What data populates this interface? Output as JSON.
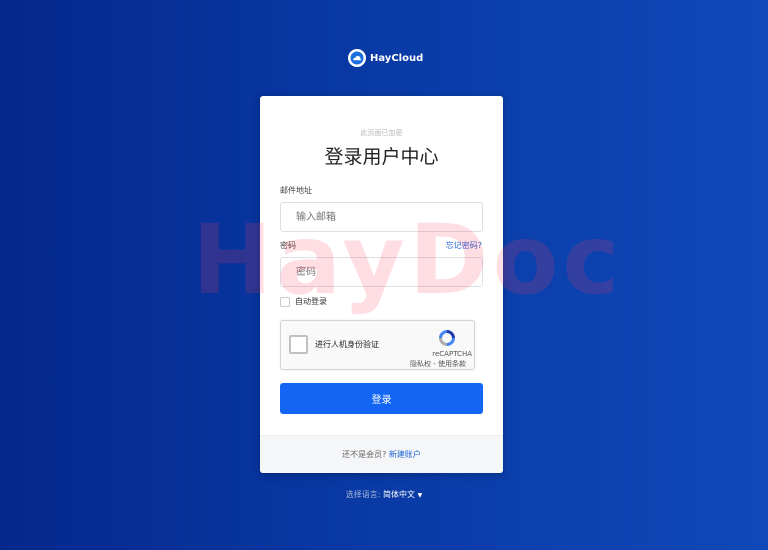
{
  "brand": {
    "name": "HayCloud",
    "icon": "cloud-logo-icon"
  },
  "card": {
    "note": "此页面已加密",
    "title": "登录用户中心",
    "email": {
      "label": "邮件地址",
      "placeholder": "输入邮箱"
    },
    "password": {
      "label": "密码",
      "placeholder": "密码",
      "forgot_link": "忘记密码?"
    },
    "remember_label": "自动登录",
    "captcha": {
      "text": "进行人机身份验证",
      "brand": "reCAPTCHA",
      "privacy": "隐私权",
      "separator": " - ",
      "terms": "使用条款"
    },
    "login_button": "登录",
    "footer": {
      "prompt": "还不是会员?",
      "link": "新建账户"
    }
  },
  "watermark": "HayDoc",
  "language": {
    "label": "选择语言:",
    "current": "简体中文"
  },
  "colors": {
    "primary": "#1366f4",
    "link": "#1e63d6",
    "background": "#0a3ca8"
  }
}
